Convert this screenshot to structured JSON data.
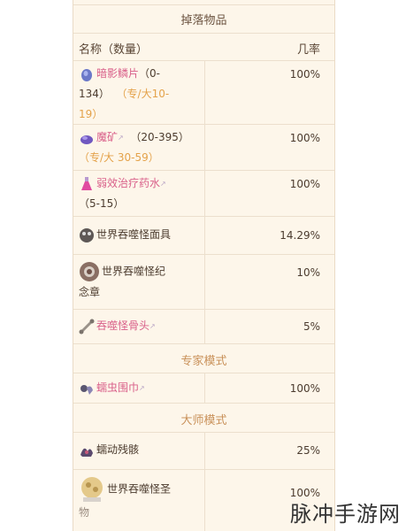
{
  "table": {
    "title": "掉落物品",
    "col_name": "名称（数量）",
    "col_rate": "几率",
    "rows": [
      {
        "name": "暗影鳞片",
        "qty_open": "（0-",
        "qty_line2": "134）",
        "qty_mode": "（专/大10-",
        "qty_line3": "19）",
        "rate": "100%",
        "icon": "shadow-scale-icon"
      },
      {
        "name": "魔矿",
        "qty": "（20-395）",
        "qty_mode": "（专/大 30-59）",
        "rate": "100%",
        "icon": "demonite-ore-icon"
      },
      {
        "name": "弱效治疗药水",
        "qty": "（5-15）",
        "rate": "100%",
        "icon": "lesser-healing-potion-icon"
      },
      {
        "name": "世界吞噬怪面具",
        "rate": "14.29%",
        "icon": "eater-mask-icon"
      },
      {
        "name": "世界吞噬怪纪",
        "name_line2": "念章",
        "rate": "10%",
        "icon": "eater-trophy-icon"
      },
      {
        "name": "吞噬怪骨头",
        "rate": "5%",
        "icon": "eater-bone-icon"
      }
    ],
    "expert_title": "专家模式",
    "expert_rows": [
      {
        "name": "蠕虫围巾",
        "rate": "100%",
        "icon": "worm-scarf-icon"
      }
    ],
    "master_title": "大师模式",
    "master_rows": [
      {
        "name": "蠕动残骸",
        "rate": "25%",
        "icon": "writhing-remains-icon"
      },
      {
        "name": "世界吞噬怪圣",
        "name_line2": "物",
        "rate": "100%",
        "icon": "eater-relic-icon"
      }
    ]
  },
  "watermark": "脉冲手游网"
}
